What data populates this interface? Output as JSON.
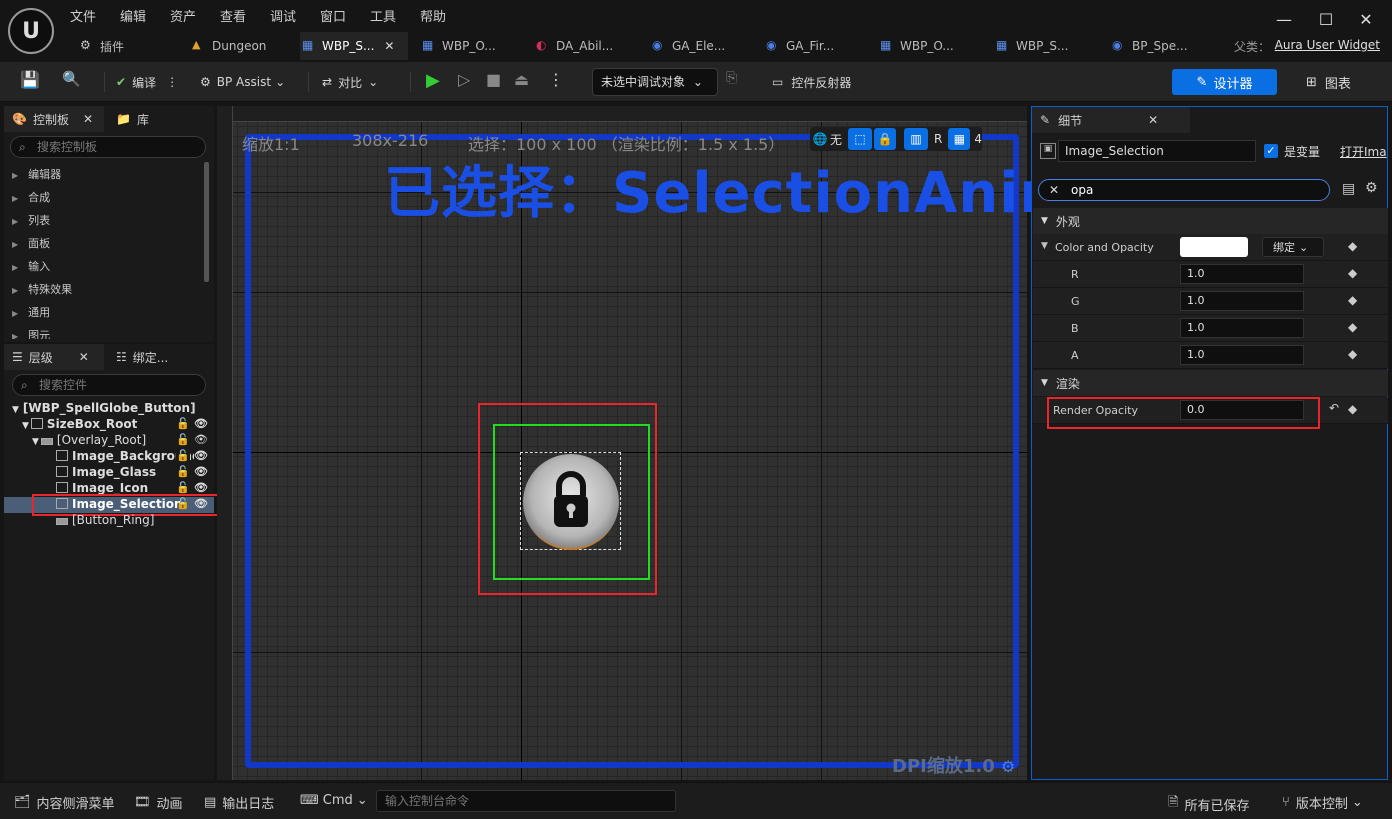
{
  "menu": [
    "文件",
    "编辑",
    "资产",
    "查看",
    "调试",
    "窗口",
    "工具",
    "帮助"
  ],
  "tabs": [
    {
      "label": "插件",
      "active": false
    },
    {
      "label": "Dungeon",
      "active": false
    },
    {
      "label": "WBP_S...",
      "active": true
    },
    {
      "label": "WBP_O...",
      "active": false
    },
    {
      "label": "DA_Abil...",
      "active": false
    },
    {
      "label": "GA_Ele...",
      "active": false
    },
    {
      "label": "GA_Fir...",
      "active": false
    },
    {
      "label": "WBP_O...",
      "active": false
    },
    {
      "label": "WBP_S...",
      "active": false
    },
    {
      "label": "BP_Spe...",
      "active": false
    }
  ],
  "parent": {
    "label": "父类：",
    "value": "Aura User Widget"
  },
  "toolbar": {
    "compile": "编译",
    "bp_assist": "BP Assist",
    "diff": "对比",
    "debug_select": "未选中调试对象",
    "widget_reflector": "控件反射器",
    "designer": "设计器",
    "graph": "图表"
  },
  "palette": {
    "tab_label": "控制板",
    "lib_label": "库",
    "search_placeholder": "搜索控制板",
    "items": [
      "编辑器",
      "合成",
      "列表",
      "面板",
      "输入",
      "特殊效果",
      "通用",
      "图元"
    ]
  },
  "hierarchy": {
    "tab_label": "层级",
    "bind_label": "绑定...",
    "search_placeholder": "搜索控件",
    "root": "[WBP_SpellGlobe_Button]",
    "nodes": [
      {
        "label": "SizeBox_Root",
        "bold": true
      },
      {
        "label": "[Overlay_Root]",
        "bold": false
      },
      {
        "label": "Image_Background",
        "bold": true
      },
      {
        "label": "Image_Glass",
        "bold": true
      },
      {
        "label": "Image_Icon",
        "bold": true
      },
      {
        "label": "Image_Selection",
        "bold": true
      },
      {
        "label": "[Button_Ring]",
        "bold": false
      }
    ]
  },
  "canvas": {
    "zoom": "缩放1:1",
    "size": "308x-216",
    "selection": "选择：100 x 100 （渲染比例：1.5 x 1.5）",
    "selected_anim": "已选择：SelectionAnim",
    "dpi": "DPI缩放1.0",
    "toggle_none": "无",
    "toggle_r": "R",
    "grid_num": "4"
  },
  "details": {
    "tab_label": "细节",
    "widget_name": "Image_Selection",
    "is_variable_label": "是变量",
    "open_label": "打开Ima",
    "filter": "opa",
    "section_appearance": "外观",
    "color_opacity_label": "Color and Opacity",
    "bind_label": "绑定",
    "channels": [
      {
        "name": "R",
        "value": "1.0"
      },
      {
        "name": "G",
        "value": "1.0"
      },
      {
        "name": "B",
        "value": "1.0"
      },
      {
        "name": "A",
        "value": "1.0"
      }
    ],
    "section_render": "渲染",
    "render_opacity_label": "Render Opacity",
    "render_opacity_value": "0.0"
  },
  "statusbar": {
    "content_drawer": "内容侧滑菜单",
    "animation": "动画",
    "output_log": "输出日志",
    "cmd": "Cmd",
    "cmd_placeholder": "输入控制台命令",
    "all_saved": "所有已保存",
    "version_control": "版本控制"
  },
  "colors": {
    "accent": "#0a6fe3",
    "highlight_red": "#e8262b",
    "selection_green": "#22dd22",
    "canvas_blue": "#1a4fe6"
  }
}
